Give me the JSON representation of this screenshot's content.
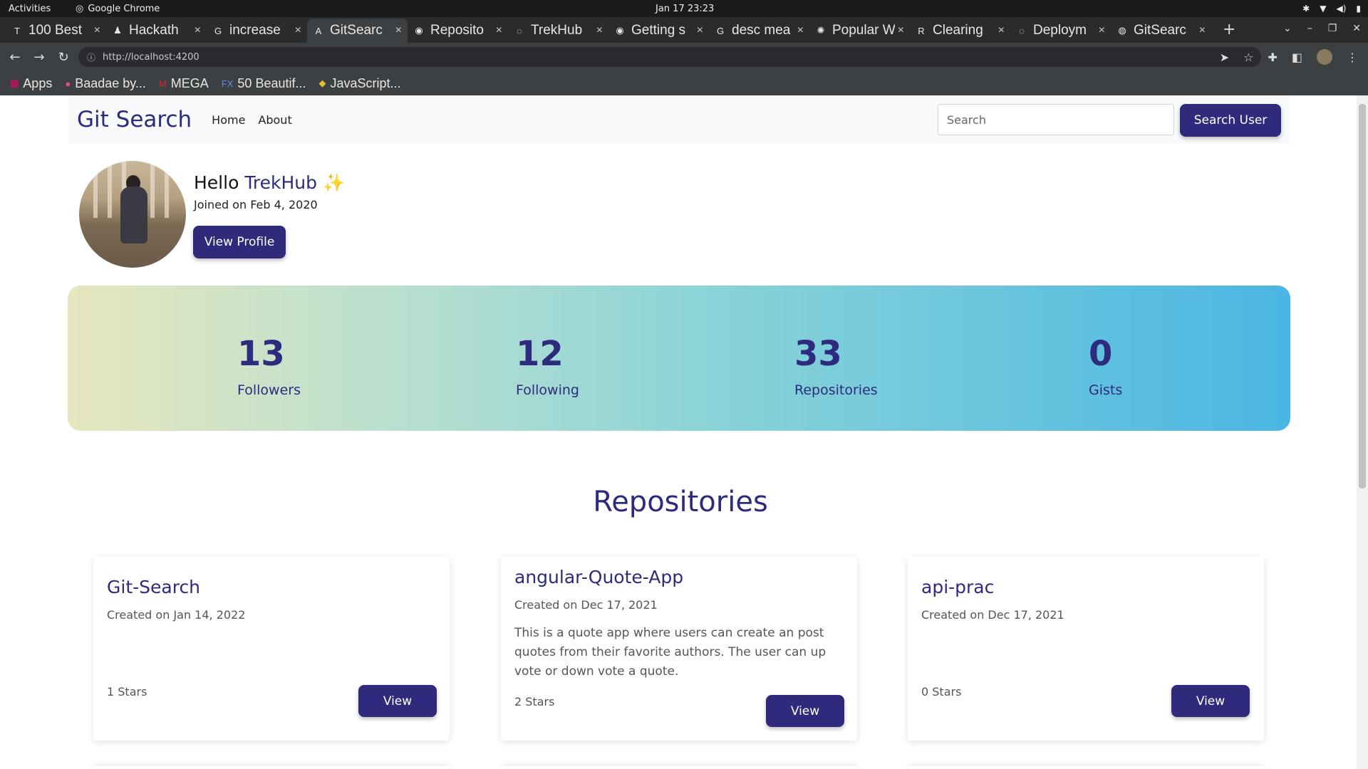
{
  "system": {
    "activities": "Activities",
    "app_name": "Google Chrome",
    "clock": "Jan 17  23:23"
  },
  "browser": {
    "tabs": [
      {
        "label": "100 Best",
        "favicon": "T",
        "active": false
      },
      {
        "label": "Hackath",
        "favicon": "♟",
        "active": false
      },
      {
        "label": "increase",
        "favicon": "G",
        "active": false
      },
      {
        "label": "GitSearc",
        "favicon": "A",
        "active": true
      },
      {
        "label": "Reposito",
        "favicon": "◉",
        "active": false
      },
      {
        "label": "TrekHub",
        "favicon": "◌",
        "active": false
      },
      {
        "label": "Getting s",
        "favicon": "◉",
        "active": false
      },
      {
        "label": "desc mea",
        "favicon": "G",
        "active": false
      },
      {
        "label": "Popular W",
        "favicon": "✺",
        "active": false
      },
      {
        "label": "Clearing",
        "favicon": "R",
        "active": false
      },
      {
        "label": "Deploym",
        "favicon": "◌",
        "active": false
      },
      {
        "label": "GitSearc",
        "favicon": "◍",
        "active": false
      }
    ],
    "url": "http://localhost:4200",
    "bookmarks": [
      {
        "label": "Apps",
        "icon": "apps-grid-icon"
      },
      {
        "label": "Baadae by...",
        "icon": "dribbble-icon"
      },
      {
        "label": "MEGA",
        "icon": "mega-icon"
      },
      {
        "label": "50 Beautif...",
        "icon": "fx-icon"
      },
      {
        "label": "JavaScript...",
        "icon": "js-icon"
      }
    ]
  },
  "navbar": {
    "brand": "Git Search",
    "links": [
      "Home",
      "About"
    ],
    "search_placeholder": "Search",
    "search_button": "Search User"
  },
  "profile": {
    "hello": "Hello",
    "username": "TrekHub",
    "sparkle": "✨",
    "joined": "Joined on Feb 4, 2020",
    "view_profile": "View Profile"
  },
  "stats": [
    {
      "value": "13",
      "label": "Followers"
    },
    {
      "value": "12",
      "label": "Following"
    },
    {
      "value": "33",
      "label": "Repositories"
    },
    {
      "value": "0",
      "label": "Gists"
    }
  ],
  "repos_title": "Repositories",
  "repos": [
    {
      "name": "Git-Search",
      "created": "Created on Jan 14, 2022",
      "description": "",
      "stars": "1 Stars",
      "button": "View"
    },
    {
      "name": "angular-Quote-App",
      "created": "Created on Dec 17, 2021",
      "description": "This is a quote app where users can create an post quotes from their favorite authors. The user can up vote or down vote a quote.",
      "stars": "2 Stars",
      "button": "View"
    },
    {
      "name": "api-prac",
      "created": "Created on Dec 17, 2021",
      "description": "",
      "stars": "0 Stars",
      "button": "View"
    }
  ],
  "colors": {
    "brand": "#2e2a7e",
    "button": "#2f2a7b",
    "gradient_start": "#e6e7bd",
    "gradient_end": "#4ab6e3"
  }
}
